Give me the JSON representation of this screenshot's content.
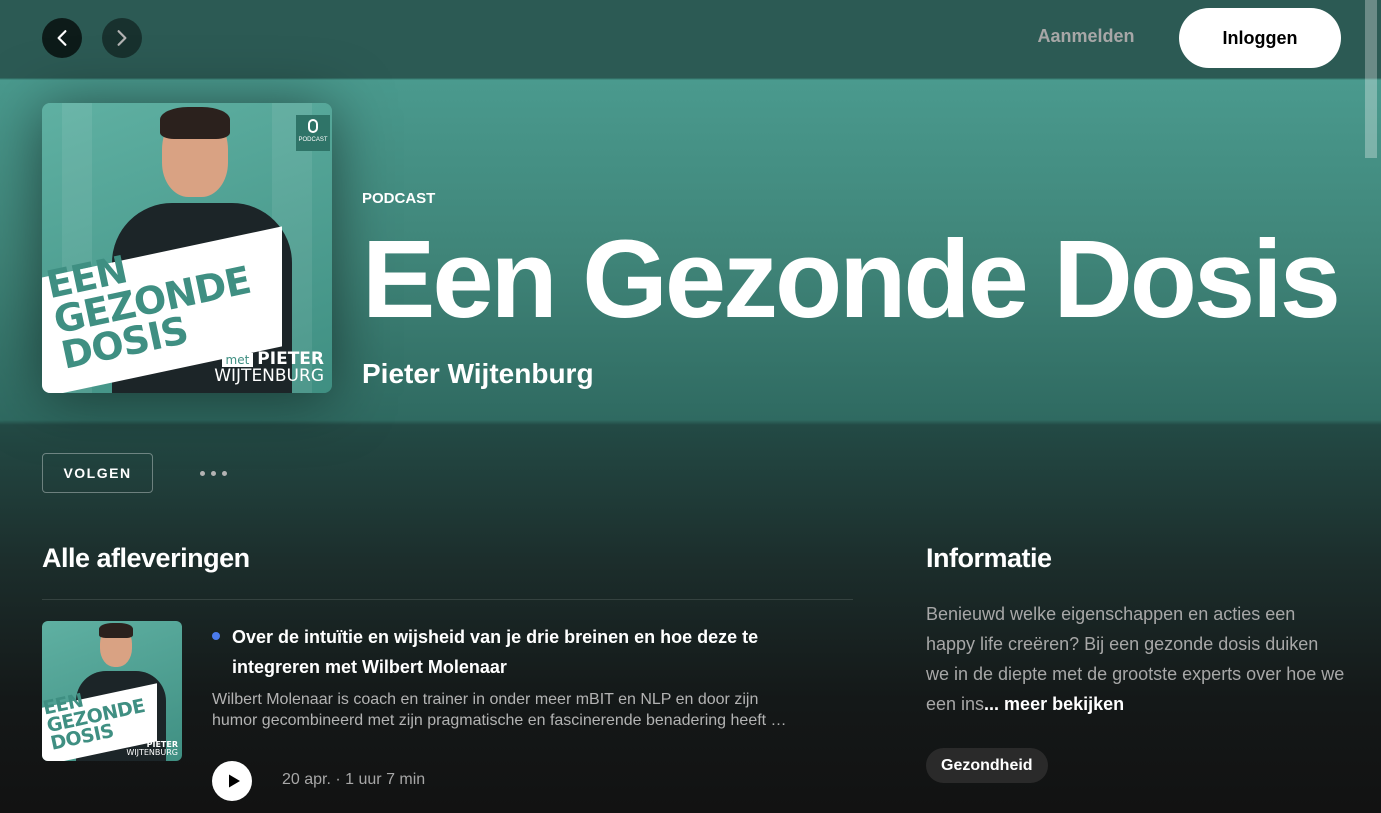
{
  "topbar": {
    "back_icon": "chevron-left-icon",
    "forward_icon": "chevron-right-icon",
    "signup_label": "Aanmelden",
    "login_label": "Inloggen"
  },
  "header": {
    "type_label": "PODCAST",
    "title": "Een Gezonde Dosis",
    "publisher": "Pieter Wijtenburg",
    "cover": {
      "line1": "EEN",
      "line2": "GEZONDE",
      "line3": "DOSIS",
      "met": "met",
      "first_name": "PIETER",
      "last_name": "WIJTENBURG",
      "badge": "PODCAST"
    }
  },
  "actions": {
    "follow_label": "VOLGEN",
    "more_icon": "more-options-icon"
  },
  "episodes": {
    "section_title": "Alle afleveringen",
    "items": [
      {
        "title": "Over de intuïtie en wijsheid van je drie breinen en hoe deze te integreren met Wilbert Molenaar",
        "description_line1": "Wilbert Molenaar is coach en trainer in onder meer mBIT en NLP en door zijn",
        "description_line2": "humor gecombineerd met zijn pragmatische en fascinerende benadering heeft …",
        "meta": "20 apr. · 1 uur 7 min"
      }
    ]
  },
  "info": {
    "section_title": "Informatie",
    "text": "Benieuwd welke eigenschappen en acties een happy life creëren? Bij een gezonde dosis duiken we in de diepte met de grootste experts over hoe we een ins",
    "more_label": "... meer bekijken",
    "category": "Gezondheid"
  },
  "colors": {
    "accent": "#4a9a8e",
    "new_dot": "#4b7bec",
    "background": "#121212"
  }
}
